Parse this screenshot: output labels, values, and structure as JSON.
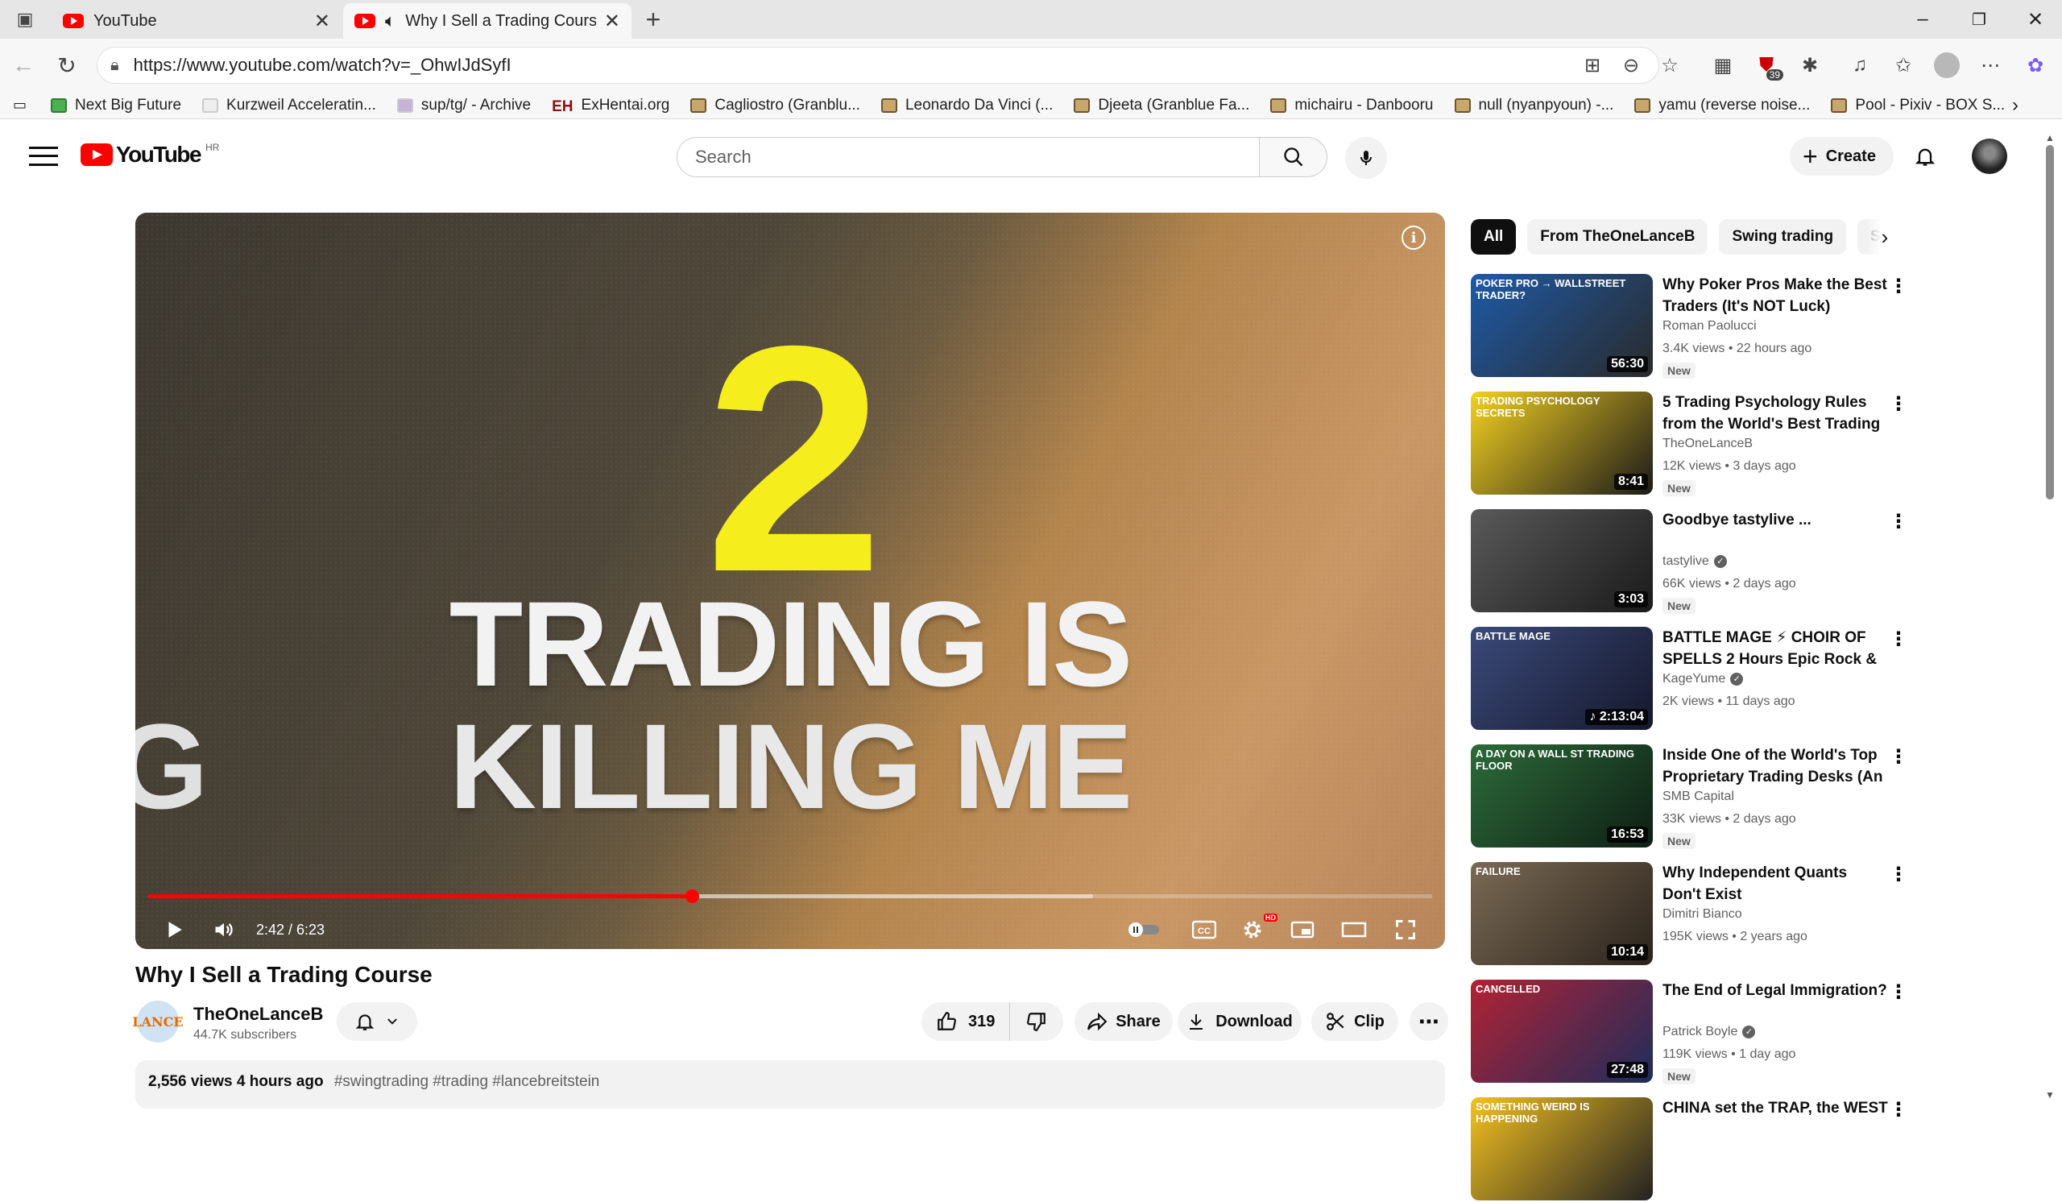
{
  "browser": {
    "tabs": [
      {
        "title": "YouTube"
      },
      {
        "title": "Why I Sell a Trading Course"
      }
    ],
    "new_tab": "+",
    "url": "https://www.youtube.com/watch?v=_OhwIJdSyfI",
    "extension_badge": "39",
    "bookmarks": [
      {
        "label": "Next Big Future"
      },
      {
        "label": "Kurzweil Acceleratin..."
      },
      {
        "label": "sup/tg/ - Archive"
      },
      {
        "label": "ExHentai.org"
      },
      {
        "label": "Cagliostro (Granblu..."
      },
      {
        "label": "Leonardo Da Vinci (..."
      },
      {
        "label": "Djeeta (Granblue Fa..."
      },
      {
        "label": "michairu - Danbooru"
      },
      {
        "label": "null (nyanpyoun) -..."
      },
      {
        "label": "yamu (reverse noise..."
      },
      {
        "label": "Pool - Pixiv - BOX S..."
      }
    ]
  },
  "masthead": {
    "logo_text": "YouTube",
    "country_code": "HR",
    "search_placeholder": "Search",
    "create_label": "Create"
  },
  "player": {
    "big_number": "2",
    "headline_line1": "TRADING IS",
    "headline_line2": "KILLING ME",
    "edge_letter": "G",
    "current_time": "2:42",
    "duration": "6:23",
    "time_display": "2:42 / 6:23",
    "progress_fraction": 0.4235,
    "hd_badge": "HD"
  },
  "video": {
    "title": "Why I Sell a Trading Course",
    "channel_name": "TheOneLanceB",
    "channel_avatar_text": "LANCE",
    "subscribers": "44.7K subscribers",
    "likes": "319",
    "share_label": "Share",
    "download_label": "Download",
    "clip_label": "Clip",
    "views_date": "2,556 views  4 hours ago",
    "hashtags": "#swingtrading #trading #lancebreitstein"
  },
  "chips": [
    "All",
    "From TheOneLanceB",
    "Swing trading",
    "S"
  ],
  "related": [
    {
      "title": "Why Poker Pros Make the Best Traders (It's NOT Luck)",
      "channel": "Roman Paolucci",
      "verified": false,
      "meta": "3.4K views • 22 hours ago",
      "badge": "New",
      "duration": "56:30",
      "thumb_text": "POKER PRO → WALLSTREET TRADER?",
      "thumb_colors": [
        "#1e5aa8",
        "#2a2a2a"
      ]
    },
    {
      "title": "5 Trading Psychology Rules from the World's Best Trading ...",
      "channel": "TheOneLanceB",
      "verified": false,
      "meta": "12K views • 3 days ago",
      "badge": "New",
      "duration": "8:41",
      "thumb_text": "TRADING PSYCHOLOGY SECRETS",
      "thumb_colors": [
        "#f4d21f",
        "#1a1a1a"
      ]
    },
    {
      "title": "Goodbye tastylive ...",
      "channel": "tastylive",
      "verified": true,
      "meta": "66K views • 2 days ago",
      "badge": "New",
      "duration": "3:03",
      "thumb_text": "",
      "thumb_colors": [
        "#5a5a5a",
        "#1a1a1a"
      ]
    },
    {
      "title": "BATTLE MAGE ⚡ CHOIR OF SPELLS 2 Hours Epic Rock & ...",
      "channel": "KageYume",
      "verified": true,
      "meta": "2K views • 11 days ago",
      "badge": "",
      "duration": "♪ 2:13:04",
      "thumb_text": "BATTLE MAGE",
      "thumb_colors": [
        "#3b4a7a",
        "#15182b"
      ]
    },
    {
      "title": "Inside One of the World's Top Proprietary Trading Desks (An ...",
      "channel": "SMB Capital",
      "verified": false,
      "meta": "33K views • 2 days ago",
      "badge": "New",
      "duration": "16:53",
      "thumb_text": "A DAY ON A WALL ST TRADING FLOOR",
      "thumb_colors": [
        "#2d6b3a",
        "#0e1e14"
      ]
    },
    {
      "title": "Why Independent Quants Don't Exist",
      "channel": "Dimitri Bianco",
      "verified": false,
      "meta": "195K views • 2 years ago",
      "badge": "",
      "duration": "10:14",
      "thumb_text": "FAILURE",
      "thumb_colors": [
        "#7a6a55",
        "#2b231b"
      ]
    },
    {
      "title": "The End of Legal Immigration?",
      "channel": "Patrick Boyle",
      "verified": true,
      "meta": "119K views • 1 day ago",
      "badge": "New",
      "duration": "27:48",
      "thumb_text": "CANCELLED",
      "thumb_colors": [
        "#b22234",
        "#1d2d5a"
      ]
    },
    {
      "title": "CHINA set the TRAP, the WEST",
      "channel": "",
      "verified": false,
      "meta": "",
      "badge": "",
      "duration": "",
      "thumb_text": "SOMETHING WEIRD IS HAPPENING",
      "thumb_colors": [
        "#f4c21f",
        "#222"
      ]
    }
  ]
}
